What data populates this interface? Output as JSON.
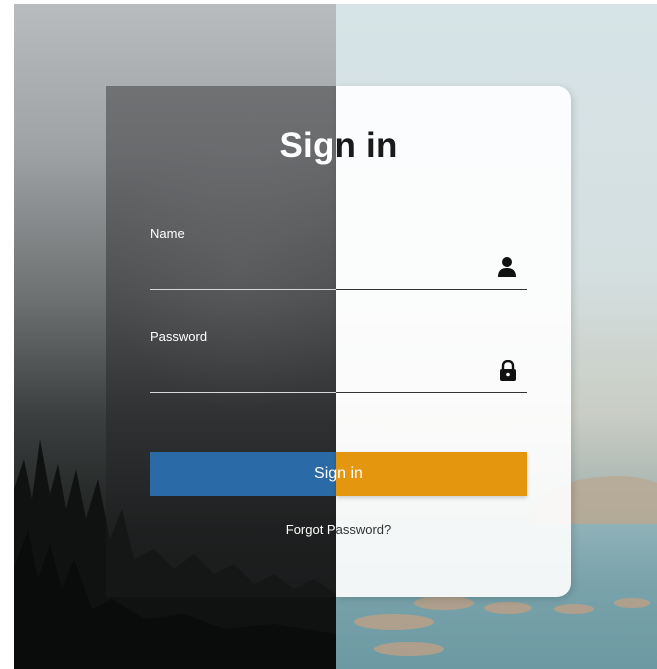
{
  "form": {
    "title": "Sign in",
    "name_label": "Name",
    "name_value": "",
    "password_label": "Password",
    "password_value": "",
    "submit_label": "Sign in",
    "forgot_link": "Forgot Password?"
  },
  "icons": {
    "name_field": "user-icon",
    "password_field": "lock-icon"
  },
  "colors": {
    "button_left": "#2a6aa6",
    "button_right": "#e3960e"
  }
}
